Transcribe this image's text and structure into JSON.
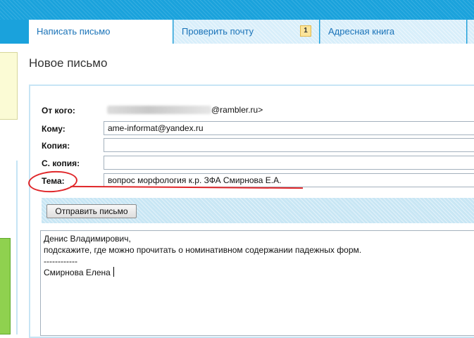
{
  "tabs": [
    {
      "label": "Написать письмо",
      "active": true
    },
    {
      "label": "Проверить почту",
      "badge": "1"
    },
    {
      "label": "Адресная книга"
    }
  ],
  "page_title": "Новое письмо",
  "form": {
    "from_label": "От кого:",
    "from_domain": "@rambler.ru>",
    "to_label": "Кому:",
    "to_value": "ame-informat@yandex.ru",
    "cc_label": "Копия:",
    "cc_value": "",
    "bcc_label": "С. копия:",
    "bcc_value": "",
    "subject_label": "Тема:",
    "subject_value": "вопрос морфология к.р. ЗФА Смирнова Е.А."
  },
  "send_label": "Отправить письмо",
  "message_lines": [
    "Денис Владимирович,",
    "подскажите, где можно прочитать о номинативном содержании падежных форм.",
    "------------",
    "Смирнова Елена"
  ],
  "colors": {
    "tab_bar": "#1aa2dc",
    "link_blue": "#1a73b8",
    "annotation_red": "#e0272a"
  }
}
